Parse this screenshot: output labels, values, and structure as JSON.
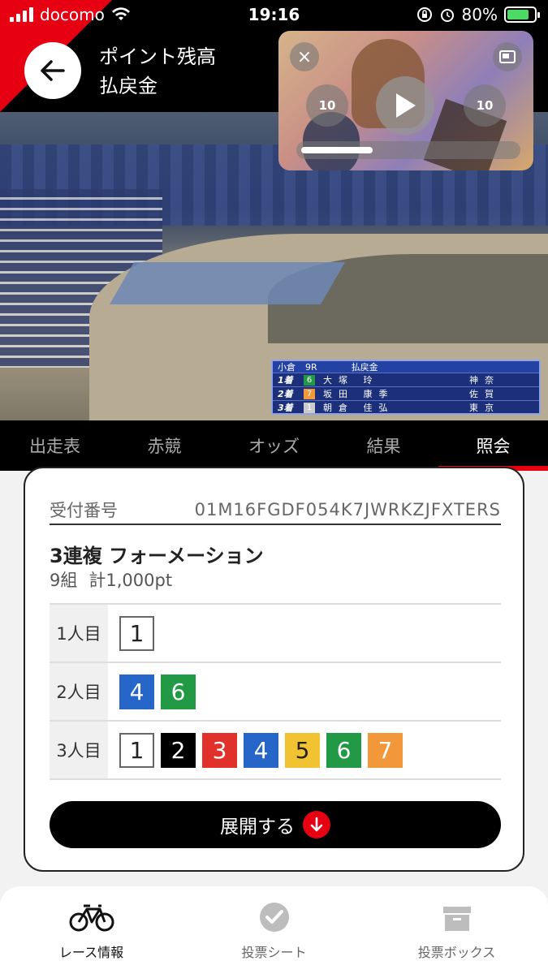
{
  "status_bar": {
    "carrier": "docomo",
    "time": "19:16",
    "battery": "80%",
    "battery_level": 0.8
  },
  "header": {
    "title_line1": "ポイント残高",
    "title_line2": "払戻金"
  },
  "player": {
    "skip_back": "10",
    "skip_forward": "10",
    "progress": 0.32
  },
  "scoreboard": {
    "venue": "小倉",
    "race": "9R",
    "mode": "払戻金",
    "rows": [
      {
        "place": "1着",
        "num": "6",
        "name": "大塚 玲",
        "pref": "神奈"
      },
      {
        "place": "2着",
        "num": "7",
        "name": "坂田 康季",
        "pref": "佐賀"
      },
      {
        "place": "3着",
        "num": "1",
        "name": "朝倉 佳弘",
        "pref": "東京"
      }
    ],
    "colors": {
      "6": "#229944",
      "7": "#f3983a",
      "1": "#cccccc"
    }
  },
  "tabs": [
    "出走表",
    "赤競",
    "オッズ",
    "結果",
    "照会"
  ],
  "active_tab": 4,
  "bet": {
    "receipt_label": "受付番号",
    "receipt_number": "01M16FGDF054K7JWRKZJFXTERS",
    "type": "3連複 フォーメーション",
    "combos": "9組",
    "total": "計1,000pt",
    "rows": [
      {
        "label": "1人目",
        "numbers": [
          "1"
        ]
      },
      {
        "label": "2人目",
        "numbers": [
          "4",
          "6"
        ]
      },
      {
        "label": "3人目",
        "numbers": [
          "1",
          "2",
          "3",
          "4",
          "5",
          "6",
          "7"
        ]
      }
    ],
    "expand_label": "展開する"
  },
  "bottom_nav": [
    {
      "label": "レース情報",
      "icon": "bicycle-icon",
      "active": true
    },
    {
      "label": "投票シート",
      "icon": "check-circle-icon",
      "active": false
    },
    {
      "label": "投票ボックス",
      "icon": "box-icon",
      "active": false
    }
  ]
}
